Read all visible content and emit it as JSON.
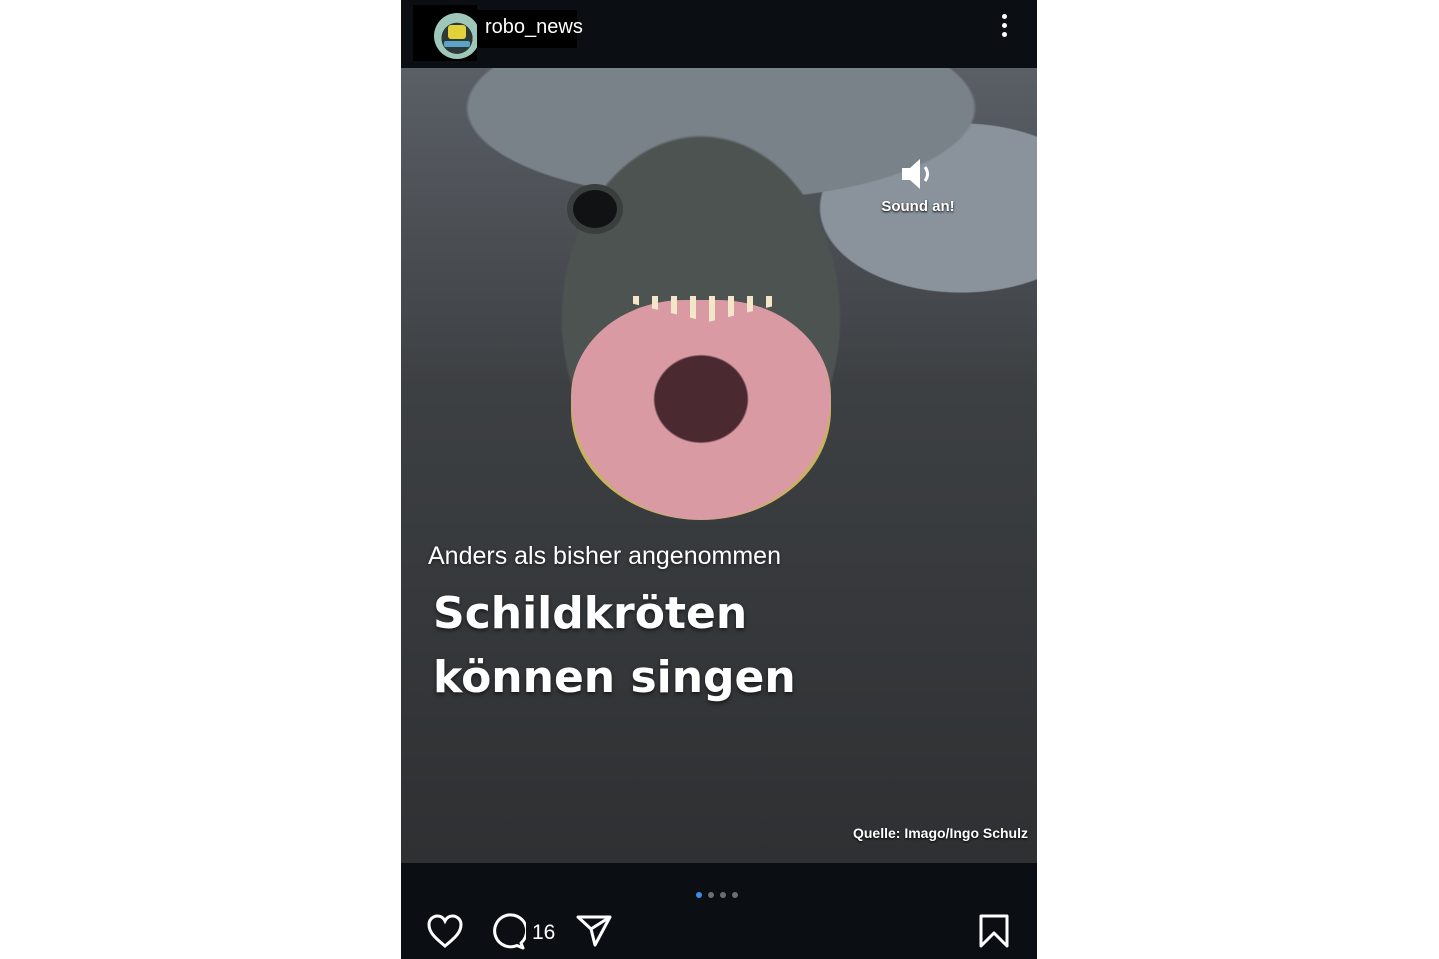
{
  "post": {
    "username": "robo_news",
    "sound_label": "Sound an!",
    "kicker": "Anders als bisher angenommen",
    "headline": "Schildkröten können singen",
    "credit": "Quelle: Imago/Ingo Schulz",
    "carousel": {
      "total": 4,
      "active": 1
    },
    "comment_count": "16"
  },
  "icons": {
    "more": "more-vertical-icon",
    "sound": "speaker-icon",
    "like": "heart-icon",
    "comment": "comment-icon",
    "share": "send-icon",
    "save": "bookmark-icon"
  },
  "colors": {
    "background": "#0b0f14",
    "active_dot": "#3a8ee6",
    "inactive_dot": "#6b6f75"
  }
}
